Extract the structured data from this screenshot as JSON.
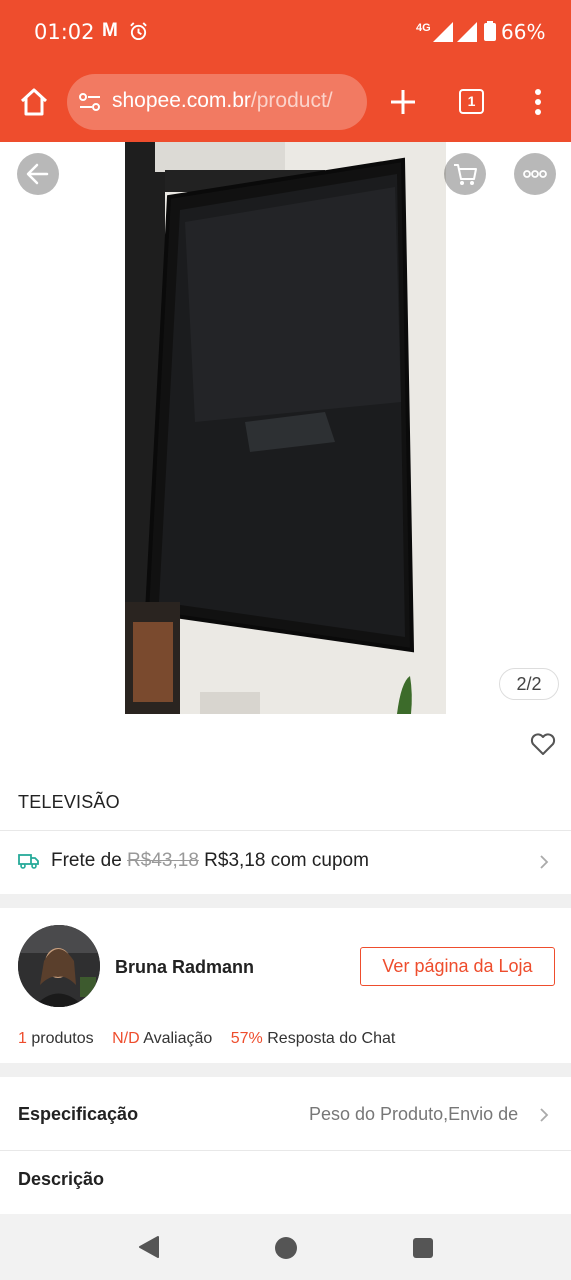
{
  "status_bar": {
    "time": "01:02",
    "notification_icons": [
      "gmail-icon",
      "alarm-icon"
    ],
    "gmail_glyph": "M",
    "network": "4G",
    "battery": "66%"
  },
  "browser": {
    "url_domain": "shopee.com.br",
    "url_path": "/product/",
    "tab_count": "1"
  },
  "gallery": {
    "pager": "2/2"
  },
  "product": {
    "title": "TELEVISÃO"
  },
  "shipping": {
    "prefix": "Frete de",
    "old_price": "R$43,18",
    "new_price": "R$3,18",
    "suffix": "com cupom"
  },
  "seller": {
    "name": "Bruna Radmann",
    "shop_button": "Ver página da Loja",
    "stats": [
      {
        "value": "1",
        "label": "produtos"
      },
      {
        "value": "N/D",
        "label": "Avaliação"
      },
      {
        "value": "57%",
        "label": "Resposta do Chat"
      }
    ]
  },
  "spec": {
    "label": "Especificação",
    "value": "Peso do Produto,Envio de"
  },
  "description": {
    "label": "Descrição"
  },
  "colors": {
    "brand": "#ee4d2d",
    "url_box": "#f27a62"
  }
}
